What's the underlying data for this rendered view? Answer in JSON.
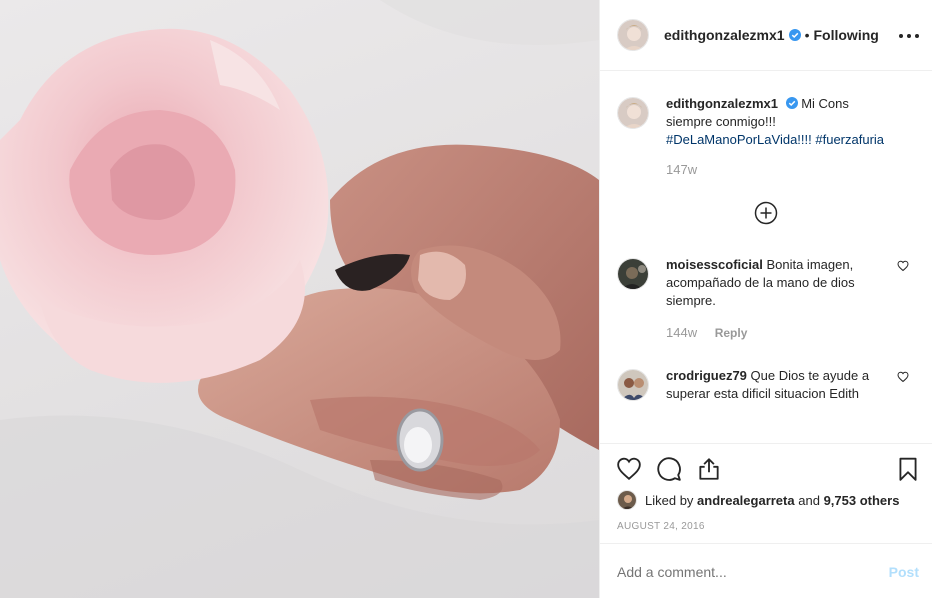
{
  "header": {
    "username": "edithgonzalezmx1",
    "separator": "•",
    "follow_status": "Following",
    "more_icon": "more-horizontal-icon",
    "verified_icon": "verified-badge-icon"
  },
  "caption": {
    "username": "edithgonzalezmx1",
    "text": "Mi Cons siempre conmigo!!!",
    "hashtags": [
      "#DeLaManoPorLaVida!!!!",
      "#fuerzafuria"
    ],
    "time": "147w"
  },
  "load_more_icon": "plus-circle-icon",
  "comments": [
    {
      "username": "moisesscoficial",
      "text": "Bonita imagen, acompañado de la mano de dios siempre.",
      "time": "144w",
      "reply_label": "Reply"
    },
    {
      "username": "crodriguez79",
      "text": "Que Dios te ayude a superar esta dificil situacion Edith"
    }
  ],
  "actions": {
    "like_icon": "heart-icon",
    "comment_icon": "comment-bubble-icon",
    "share_icon": "share-icon",
    "save_icon": "bookmark-icon"
  },
  "likes": {
    "prefix": "Liked by",
    "user": "andrealegarreta",
    "connector": "and",
    "others": "9,753 others"
  },
  "date": "AUGUST 24, 2016",
  "add_comment": {
    "placeholder": "Add a comment...",
    "post_label": "Post"
  },
  "colors": {
    "text": "#262626",
    "muted": "#999999",
    "link": "#003569",
    "verified": "#3897f0",
    "post_disabled": "#b2dffc",
    "border": "#efefef"
  }
}
